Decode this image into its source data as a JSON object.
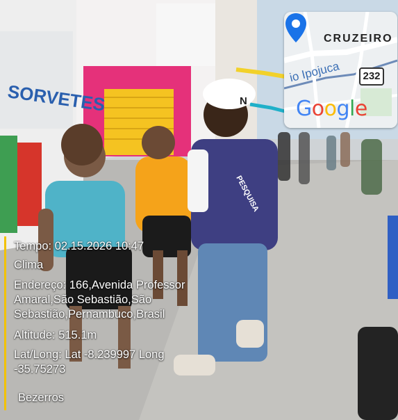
{
  "map": {
    "area_label": "CRUZEIRO",
    "street_label": "io Ipojuca",
    "route_number": "232",
    "logo_letters": [
      {
        "char": "G",
        "color": "#4285F4"
      },
      {
        "char": "o",
        "color": "#EA4335"
      },
      {
        "char": "o",
        "color": "#FBBC05"
      },
      {
        "char": "g",
        "color": "#4285F4"
      },
      {
        "char": "l",
        "color": "#34A853"
      },
      {
        "char": "e",
        "color": "#EA4335"
      }
    ],
    "pin_color": "#1a73e8"
  },
  "stamp": {
    "tempo": "Tempo: 02.15.2026 10:47",
    "clima": "Clima",
    "endereco_line1": "Endereço: 166,Avenida Professor",
    "endereco_line2": "Amaral,São Sebastião,São",
    "endereco_line3": "Sebastião,Pernambuco,Brasil",
    "altitude": "Altitude: 515.1m",
    "latlong_line1": "Lat/Long: Lat -8.239997 Long",
    "latlong_line2": "-35.75273",
    "tag": "Bezerros",
    "accent_color": "#f2c200"
  },
  "scene": {
    "shop_sign": "SORVETES",
    "vest_text": "PESQUISA",
    "cap_text": "N"
  }
}
